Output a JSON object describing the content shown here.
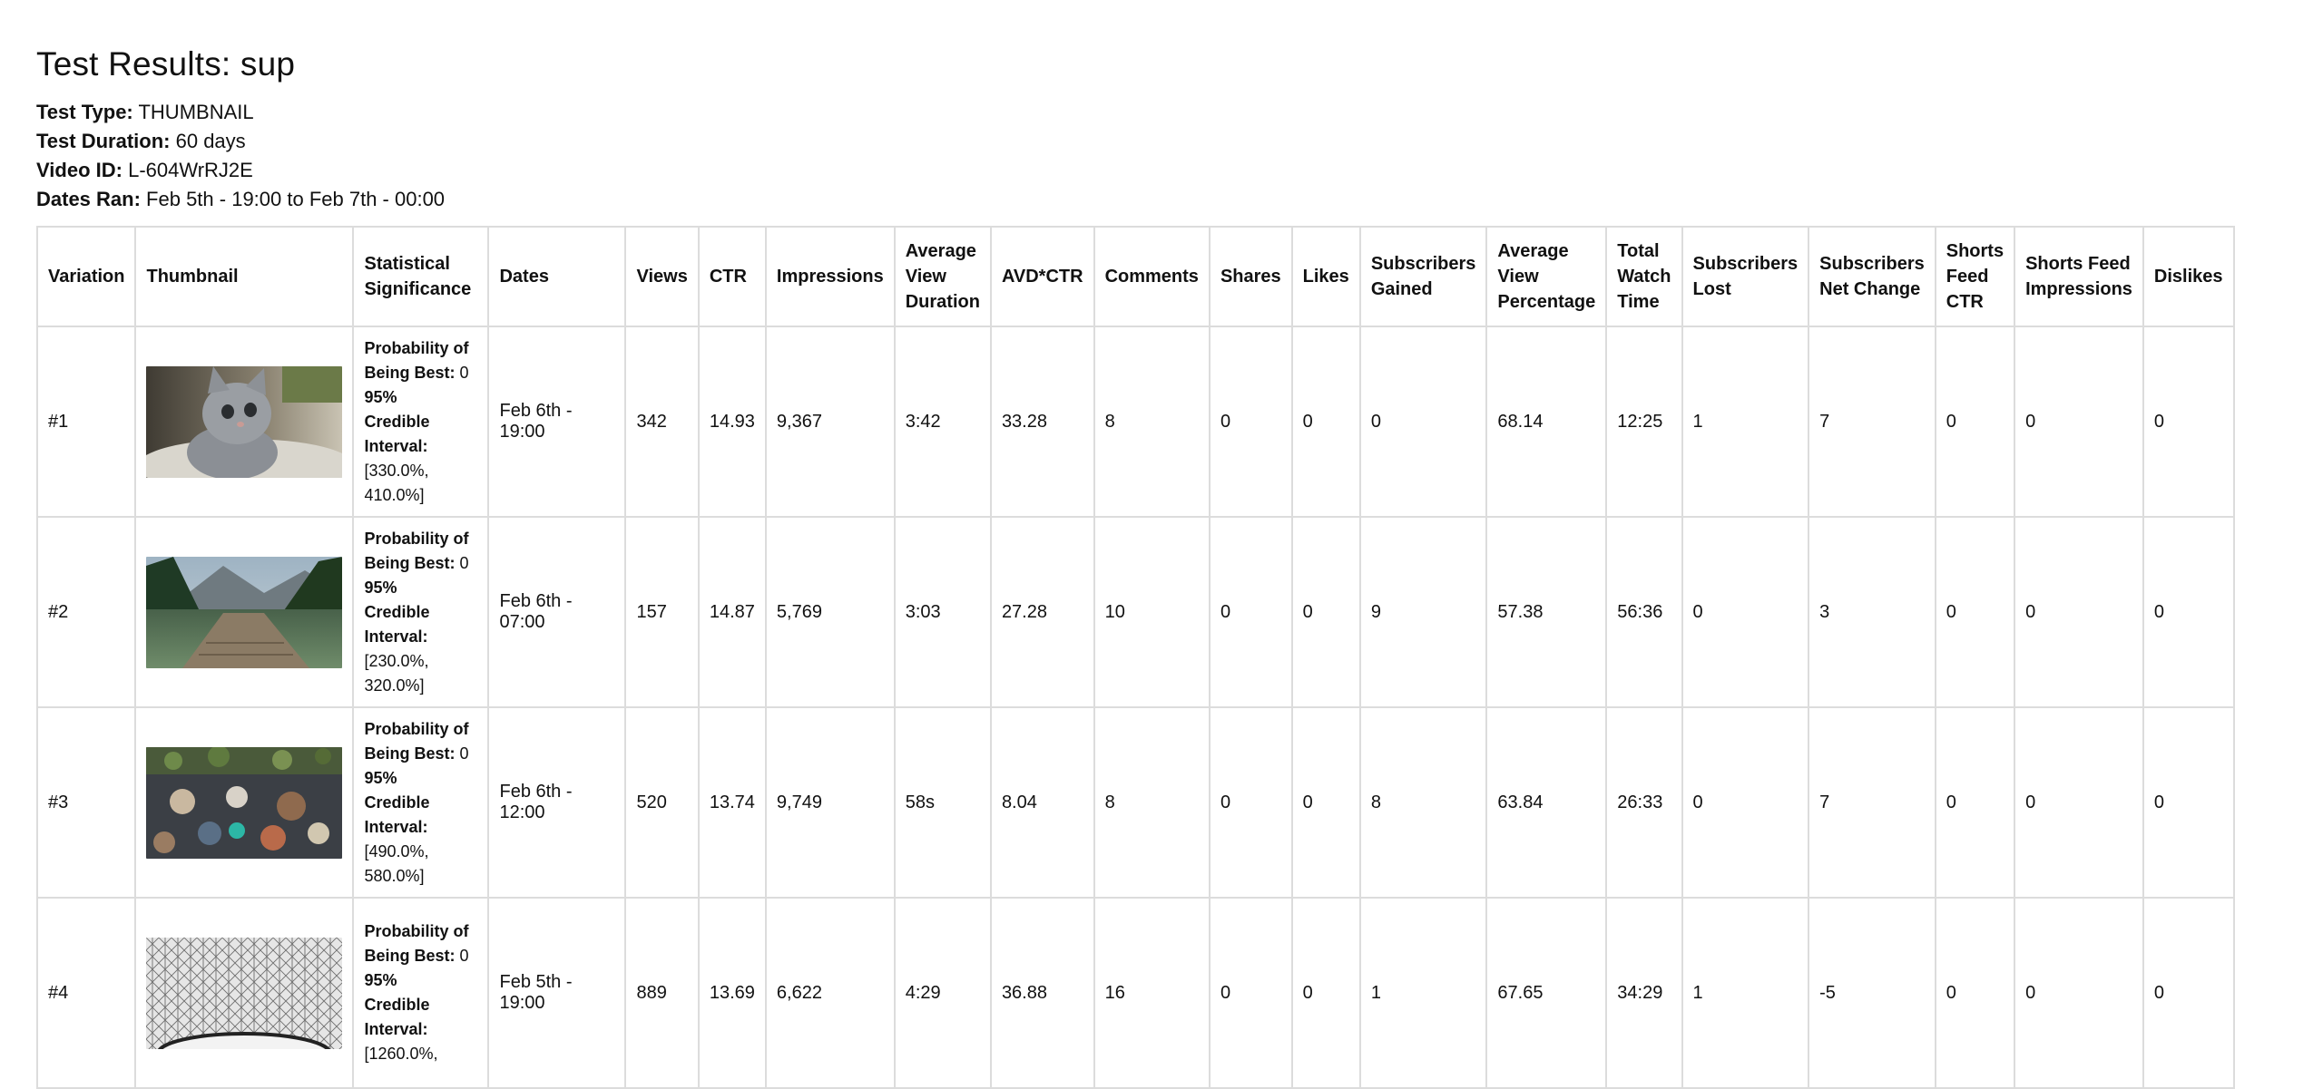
{
  "page": {
    "title": "Test Results: sup"
  },
  "meta": {
    "test_type_label": "Test Type:",
    "test_type": "THUMBNAIL",
    "duration_label": "Test Duration:",
    "duration": "60 days",
    "video_id_label": "Video ID:",
    "video_id": "L-604WrRJ2E",
    "dates_label": "Dates Ran:",
    "dates": "Feb 5th - 19:00 to Feb 7th - 00:00"
  },
  "table": {
    "headers": {
      "variation": "Variation",
      "thumbnail": "Thumbnail",
      "stat_sig_1": "Statistical",
      "stat_sig_2": "Significance",
      "dates": "Dates",
      "views": "Views",
      "ctr": "CTR",
      "impressions": "Impressions",
      "avd_1": "Average",
      "avd_2": "View",
      "avd_3": "Duration",
      "avd_ctr": "AVD*CTR",
      "comments": "Comments",
      "shares": "Shares",
      "likes": "Likes",
      "subs_gained_1": "Subscribers",
      "subs_gained_2": "Gained",
      "avp_1": "Average",
      "avp_2": "View",
      "avp_3": "Percentage",
      "twt_1": "Total",
      "twt_2": "Watch",
      "twt_3": "Time",
      "subs_lost_1": "Subscribers",
      "subs_lost_2": "Lost",
      "subs_net_1": "Subscribers",
      "subs_net_2": "Net Change",
      "sf_ctr_1": "Shorts",
      "sf_ctr_2": "Feed",
      "sf_ctr_3": "CTR",
      "sf_imp_1": "Shorts Feed",
      "sf_imp_2": "Impressions",
      "dislikes": "Dislikes"
    },
    "stat_labels": {
      "prob_1": "Probability of",
      "prob_2": "Being Best:",
      "ci_1": "95%",
      "ci_2": "Credible",
      "ci_3": "Interval:"
    },
    "rows": [
      {
        "variation": "#1",
        "thumbnail_icon": "kitten-photo",
        "probability": "0",
        "interval_1": "[330.0%,",
        "interval_2": "410.0%]",
        "dates": "Feb 6th - 19:00",
        "views": "342",
        "ctr": "14.93",
        "impressions": "9,367",
        "avd": "3:42",
        "avd_ctr": "33.28",
        "comments": "8",
        "shares": "0",
        "likes": "0",
        "subs_gained": "0",
        "avp": "68.14",
        "twt": "12:25",
        "subs_lost": "1",
        "subs_net": "7",
        "sf_ctr": "0",
        "sf_imp": "0",
        "dislikes": "0"
      },
      {
        "variation": "#2",
        "thumbnail_icon": "lake-dock-photo",
        "probability": "0",
        "interval_1": "[230.0%,",
        "interval_2": "320.0%]",
        "dates": "Feb 6th - 07:00",
        "views": "157",
        "ctr": "14.87",
        "impressions": "5,769",
        "avd": "3:03",
        "avd_ctr": "27.28",
        "comments": "10",
        "shares": "0",
        "likes": "0",
        "subs_gained": "9",
        "avp": "57.38",
        "twt": "56:36",
        "subs_lost": "0",
        "subs_net": "3",
        "sf_ctr": "0",
        "sf_imp": "0",
        "dislikes": "0"
      },
      {
        "variation": "#3",
        "thumbnail_icon": "food-table-photo",
        "probability": "0",
        "interval_1": "[490.0%,",
        "interval_2": "580.0%]",
        "dates": "Feb 6th - 12:00",
        "views": "520",
        "ctr": "13.74",
        "impressions": "9,749",
        "avd": "58s",
        "avd_ctr": "8.04",
        "comments": "8",
        "shares": "0",
        "likes": "0",
        "subs_gained": "8",
        "avp": "63.84",
        "twt": "26:33",
        "subs_lost": "0",
        "subs_net": "7",
        "sf_ctr": "0",
        "sf_imp": "0",
        "dislikes": "0"
      },
      {
        "variation": "#4",
        "thumbnail_icon": "glass-dome-photo",
        "probability": "0",
        "interval_1": "[1260.0%,",
        "interval_2": "",
        "dates": "Feb 5th - 19:00",
        "views": "889",
        "ctr": "13.69",
        "impressions": "6,622",
        "avd": "4:29",
        "avd_ctr": "36.88",
        "comments": "16",
        "shares": "0",
        "likes": "0",
        "subs_gained": "1",
        "avp": "67.65",
        "twt": "34:29",
        "subs_lost": "1",
        "subs_net": "-5",
        "sf_ctr": "0",
        "sf_imp": "0",
        "dislikes": "0"
      }
    ]
  }
}
